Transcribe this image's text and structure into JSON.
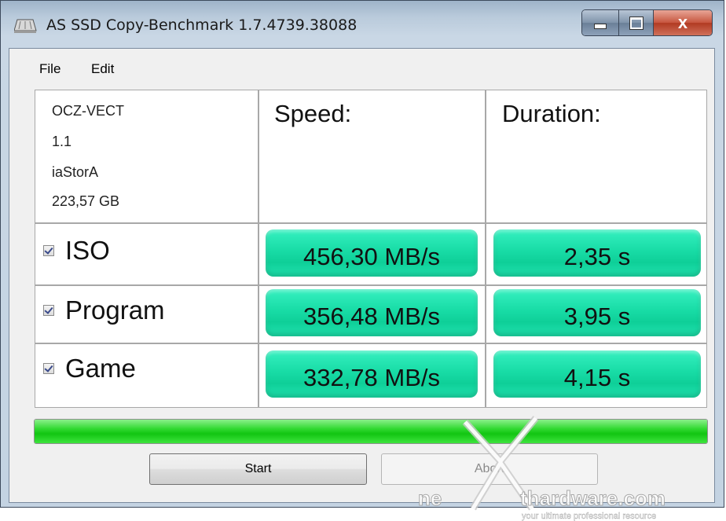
{
  "window": {
    "title": "AS SSD Copy-Benchmark 1.7.4739.38088",
    "controls": {
      "minimize_icon": "minimize-icon",
      "maximize_icon": "maximize-icon",
      "close_label": "x"
    }
  },
  "menu": {
    "items": [
      "File",
      "Edit"
    ]
  },
  "drive": {
    "model": "OCZ-VECT",
    "firmware": "1.1",
    "driver": "iaStorA",
    "capacity": "223,57 GB"
  },
  "columns": {
    "speed": "Speed:",
    "duration": "Duration:"
  },
  "rows": [
    {
      "label": "ISO",
      "checked": true,
      "speed": "456,30 MB/s",
      "duration": "2,35 s"
    },
    {
      "label": "Program",
      "checked": true,
      "speed": "356,48 MB/s",
      "duration": "3,95 s"
    },
    {
      "label": "Game",
      "checked": true,
      "speed": "332,78 MB/s",
      "duration": "4,15 s"
    }
  ],
  "progress": {
    "percent": 100,
    "color": "#22d422"
  },
  "buttons": {
    "start": "Start",
    "abort": "Abort"
  },
  "watermark": {
    "brand_left": "ne",
    "brand_right": "thardware.com",
    "tagline": "your ultimate professional resource"
  },
  "colors": {
    "result_pill": "#1adca8",
    "titlebar": "#b9cadb"
  }
}
